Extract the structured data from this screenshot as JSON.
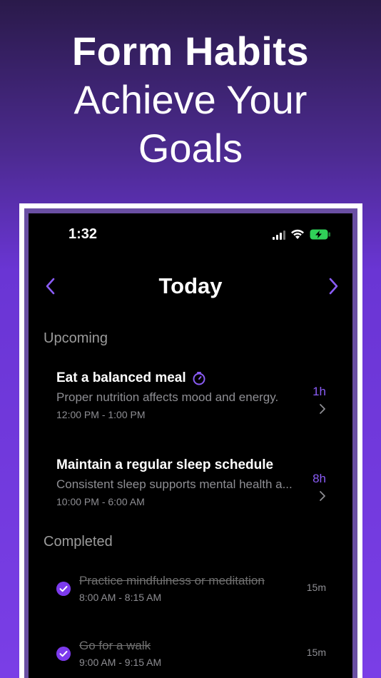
{
  "hero": {
    "line1": "Form Habits",
    "line2": "Achieve Your",
    "line3": "Goals"
  },
  "status": {
    "time": "1:32"
  },
  "nav": {
    "title": "Today",
    "prev_icon": "chevron-left-icon",
    "next_icon": "chevron-right-icon"
  },
  "sections": {
    "upcoming": "Upcoming",
    "completed": "Completed"
  },
  "upcoming": [
    {
      "title": "Eat a balanced meal",
      "description": "Proper nutrition affects mood and energy.",
      "time": "12:00 PM - 1:00 PM",
      "duration": "1h",
      "has_timer_icon": true
    },
    {
      "title": "Maintain a regular sleep schedule",
      "description": "Consistent sleep supports mental health a...",
      "time": "10:00 PM - 6:00 AM",
      "duration": "8h",
      "has_timer_icon": false
    }
  ],
  "completed": [
    {
      "title": "Practice mindfulness or meditation",
      "time": "8:00 AM - 8:15 AM",
      "duration": "15m"
    },
    {
      "title": "Go for a walk",
      "time": "9:00 AM - 9:15 AM",
      "duration": "15m"
    }
  ],
  "colors": {
    "accent": "#8a5cf6",
    "check": "#7c3aed",
    "battery": "#30d158"
  }
}
